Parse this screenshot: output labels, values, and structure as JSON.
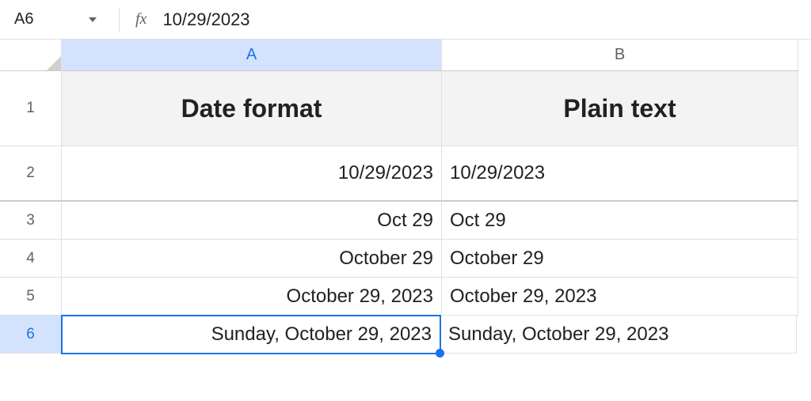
{
  "formula_bar": {
    "name_box": "A6",
    "fx_label": "fx",
    "value": "10/29/2023"
  },
  "columns": {
    "a": "A",
    "b": "B"
  },
  "rows": {
    "r1": "1",
    "r2": "2",
    "r3": "3",
    "r4": "4",
    "r5": "5",
    "r6": "6"
  },
  "cells": {
    "a1": "Date format",
    "b1": "Plain text",
    "a2": "10/29/2023",
    "b2": "10/29/2023",
    "a3": "Oct 29",
    "b3": "Oct 29",
    "a4": "October 29",
    "b4": "October 29",
    "a5": "October 29, 2023",
    "b5": "October 29, 2023",
    "a6": "Sunday, October 29, 2023",
    "b6": "Sunday, October 29, 2023"
  }
}
